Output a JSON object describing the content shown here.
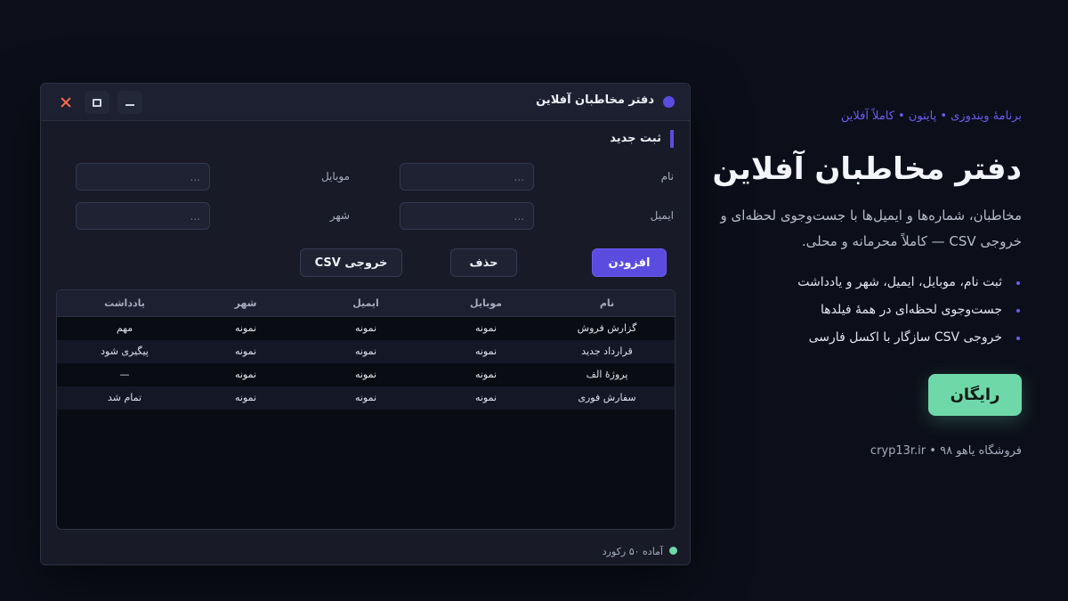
{
  "colors": {
    "accent": "#5b4ce0",
    "accent_text": "#6b5cf0",
    "cta": "#6fd8a9",
    "close": "#ff6b4a",
    "background": "#0c0f1a"
  },
  "window": {
    "title": "دفتر مخاطبان آفلاین",
    "controls": {
      "close_icon": "close-icon",
      "maximize_icon": "maximize-icon",
      "minimize_icon": "minimize-icon"
    },
    "section_title": "ثبت جدید",
    "fields": {
      "name": {
        "label": "نام",
        "placeholder": "..."
      },
      "mobile": {
        "label": "موبایل",
        "placeholder": "..."
      },
      "email": {
        "label": "ایمیل",
        "placeholder": "..."
      },
      "city": {
        "label": "شهر",
        "placeholder": "..."
      }
    },
    "buttons": {
      "add": "افزودن",
      "delete": "حذف",
      "export_csv": "خروجی CSV"
    },
    "table": {
      "headers": [
        "نام",
        "موبایل",
        "ایمیل",
        "شهر",
        "یادداشت"
      ],
      "rows": [
        [
          "گزارش فروش",
          "نمونه",
          "نمونه",
          "نمونه",
          "مهم"
        ],
        [
          "قرارداد جدید",
          "نمونه",
          "نمونه",
          "نمونه",
          "پیگیری شود"
        ],
        [
          "پروژهٔ الف",
          "نمونه",
          "نمونه",
          "نمونه",
          "—"
        ],
        [
          "سفارش فوری",
          "نمونه",
          "نمونه",
          "نمونه",
          "تمام شد"
        ]
      ]
    },
    "status": "آماده ۵۰ رکورد"
  },
  "promo": {
    "kicker": "برنامهٔ ویندوزی • پایتون • کاملاً آفلاین",
    "title": "دفتر مخاطبان آفلاین",
    "description": "مخاطبان، شماره‌ها و ایمیل‌ها با جست‌وجوی لحظه‌ای و خروجی CSV — کاملاً محرمانه و محلی.",
    "features": [
      "ثبت نام، موبایل، ایمیل، شهر و یادداشت",
      "جست‌وجوی لحظه‌ای در همهٔ فیلدها",
      "خروجی CSV سازگار با اکسل فارسی"
    ],
    "cta": "رایگان",
    "footer": "فروشگاه یاهو ۹۸ • cryp13r.ir"
  }
}
